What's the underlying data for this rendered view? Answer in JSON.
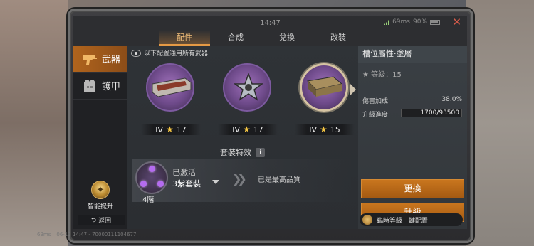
{
  "status": {
    "time": "14:47",
    "ping": "69ms",
    "battery": "90%"
  },
  "tabs": [
    {
      "label": "配件",
      "active": true
    },
    {
      "label": "合成",
      "active": false
    },
    {
      "label": "兌換",
      "active": false
    },
    {
      "label": "改裝",
      "active": false
    }
  ],
  "sidebar": {
    "items": [
      {
        "label": "武器",
        "icon": "gun-icon",
        "active": true
      },
      {
        "label": "護甲",
        "icon": "armor-vest-icon",
        "active": false
      }
    ],
    "smart_upgrade": "智能提升",
    "back": "返回"
  },
  "main": {
    "info_text": "以下配置通用所有武器",
    "slots": [
      {
        "tier": "IV",
        "stars": "17",
        "item_icon": "grip-attachment-icon",
        "selected": false
      },
      {
        "tier": "IV",
        "stars": "17",
        "item_icon": "sight-attachment-icon",
        "selected": false
      },
      {
        "tier": "IV",
        "stars": "15",
        "item_icon": "coating-plate-icon",
        "selected": true
      }
    ],
    "suit_title": "套裝特效",
    "suit": {
      "status": "已激活",
      "name": "3紫套裝",
      "level": "4階",
      "max_text": "已是最高品質"
    }
  },
  "right_panel": {
    "title": "槽位屬性·塗層",
    "level_label": "等級：15",
    "stats": [
      {
        "label": "傷害加成",
        "value": "38.0%"
      },
      {
        "label": "升級進度",
        "value": "1700/93500"
      }
    ],
    "progress_fraction": 0.018,
    "swap_button": "更換",
    "upgrade_button": "升級",
    "temp_config_button": "臨時等級一鍵配置"
  },
  "footer": {
    "ping": "69ms",
    "session": "06-12 14:47 - 70000111104677"
  },
  "colors": {
    "accent": "#c9761e",
    "active_tab": "#f4c07a",
    "purple_rarity": "#9d6fb8",
    "close": "#d55b4a"
  }
}
